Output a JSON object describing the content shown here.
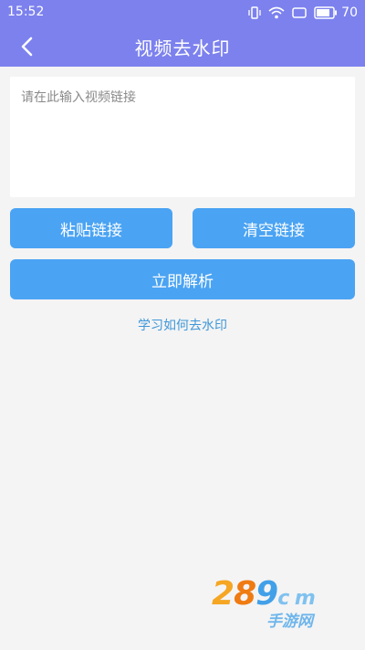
{
  "status_bar": {
    "time": "15:52",
    "icons": [
      "vibrate-icon",
      "wifi-icon",
      "screen-rotate-icon",
      "battery-icon"
    ],
    "battery_level": "70"
  },
  "header": {
    "title": "视频去水印",
    "back_icon": "back-arrow-icon",
    "background_color": "#7c81ee"
  },
  "input": {
    "placeholder": "请在此输入视频链接",
    "value": ""
  },
  "buttons": {
    "paste_label": "粘贴链接",
    "clear_label": "清空链接",
    "parse_label": "立即解析",
    "color": "#4aa3f3"
  },
  "help_link": {
    "label": "学习如何去水印",
    "color": "#3f97d8"
  },
  "watermark": {
    "digit_1": "2",
    "digit_2": "8",
    "digit_3": "9",
    "domain": "c m",
    "sub": "手游网"
  }
}
